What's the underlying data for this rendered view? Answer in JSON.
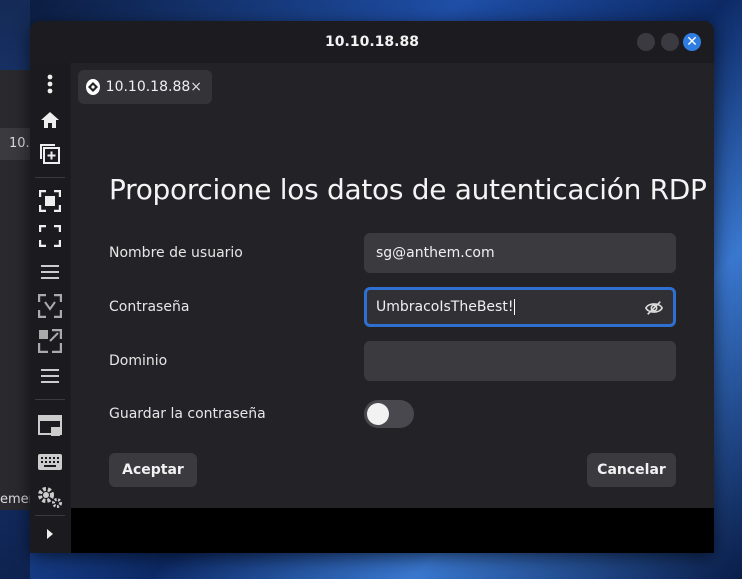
{
  "window": {
    "title": "10.10.18.88"
  },
  "background_app": {
    "tab_fragment": "10.",
    "text_fragment": "emen"
  },
  "tab": {
    "label": "10.10.18.88",
    "close_glyph": "×"
  },
  "form": {
    "heading": "Proporcione los datos de autenticación RDP",
    "username": {
      "label": "Nombre de usuario",
      "value": "sg@anthem.com"
    },
    "password": {
      "label": "Contraseña",
      "value": "UmbracoIsTheBest!"
    },
    "domain": {
      "label": "Dominio",
      "value": ""
    },
    "save_password": {
      "label": "Guardar la contraseña",
      "enabled": false
    },
    "accept_label": "Aceptar",
    "cancel_label": "Cancelar"
  },
  "colors": {
    "accent": "#2f6fd0",
    "close_button": "#2f7de1"
  },
  "sidebar": {
    "icons": [
      "menu-dots-icon",
      "home-icon",
      "new-connection-icon",
      "fit-window-icon",
      "fullscreen-icon",
      "list-icon",
      "scale-icon",
      "dynamic-resolution-icon",
      "list-icon",
      "multi-monitor-icon",
      "keyboard-icon",
      "preferences-icon",
      "expand-arrow-icon"
    ]
  }
}
